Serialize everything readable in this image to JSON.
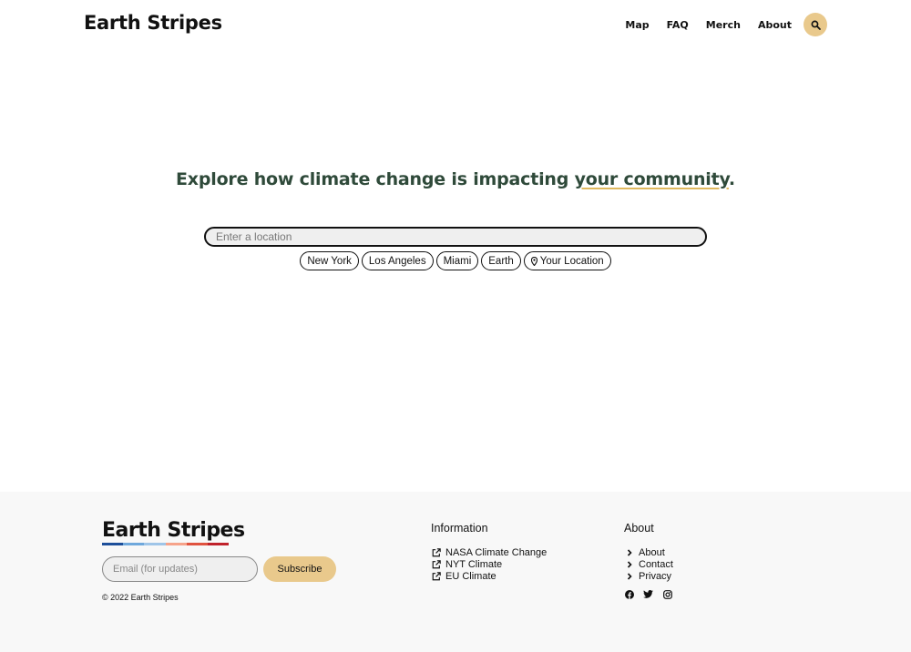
{
  "header": {
    "brand": "Earth Stripes",
    "nav": [
      "Map",
      "FAQ",
      "Merch",
      "About"
    ],
    "search_icon": "search-icon",
    "accent_color": "#e9c98c"
  },
  "hero": {
    "title_prefix": "Explore how climate change is impacting ",
    "title_highlight": "your community",
    "title_suffix": ".",
    "title_color": "#2f4a3a",
    "location_placeholder": "Enter a location",
    "chips": [
      "New York",
      "Los Angeles",
      "Miami",
      "Earth"
    ],
    "your_location": "Your Location",
    "your_location_icon": "map-marker-icon"
  },
  "footer": {
    "logo_text": "Earth Stripes",
    "stripe_colors": [
      "#1d4f9a",
      "#6fa8dc",
      "#9fc5e8",
      "#f6a38a",
      "#e0533f",
      "#c0222b"
    ],
    "email_placeholder": "Email (for updates)",
    "subscribe_label": "Subscribe",
    "copyright": "© 2022 Earth Stripes",
    "information": {
      "heading": "Information",
      "links": [
        "NASA Climate Change",
        "NYT Climate",
        "EU Climate"
      ],
      "link_icon": "external-link-icon"
    },
    "about": {
      "heading": "About",
      "links": [
        "About",
        "Contact",
        "Privacy"
      ],
      "link_icon": "chevron-right-icon",
      "social_icons": [
        "facebook-icon",
        "twitter-icon",
        "instagram-icon"
      ]
    }
  }
}
